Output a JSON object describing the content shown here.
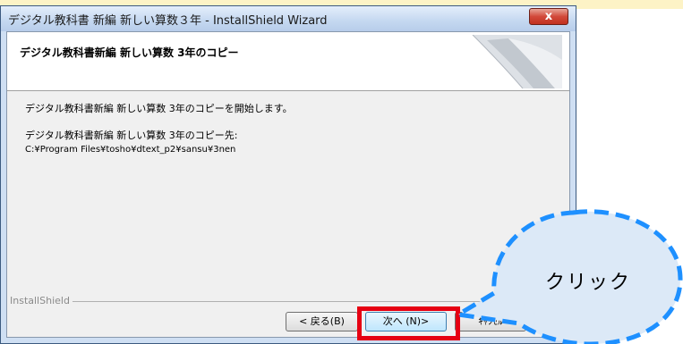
{
  "window": {
    "title": "デジタル教科書 新編 新しい算数３年 - InstallShield Wizard",
    "close_glyph": "x"
  },
  "header": {
    "title": "デジタル教科書新編 新しい算数 3年のコピー"
  },
  "content": {
    "line1": "デジタル教科書新編 新しい算数 3年のコピーを開始します。",
    "line2": "デジタル教科書新編 新しい算数 3年のコピー先:",
    "path": "C:¥Program Files¥tosho¥dtext_p2¥sansu¥3nen"
  },
  "footer": {
    "brand": "InstallShield",
    "back_label": "< 戻る(B)",
    "next_label": "次へ (N)>",
    "cancel_label": "ｷｬﾝｾﾙ"
  },
  "annotation": {
    "callout_text": "クリック",
    "highlight_color": "#e60012",
    "callout_color": "#1e90ff",
    "callout_fill": "#dce9f7"
  }
}
